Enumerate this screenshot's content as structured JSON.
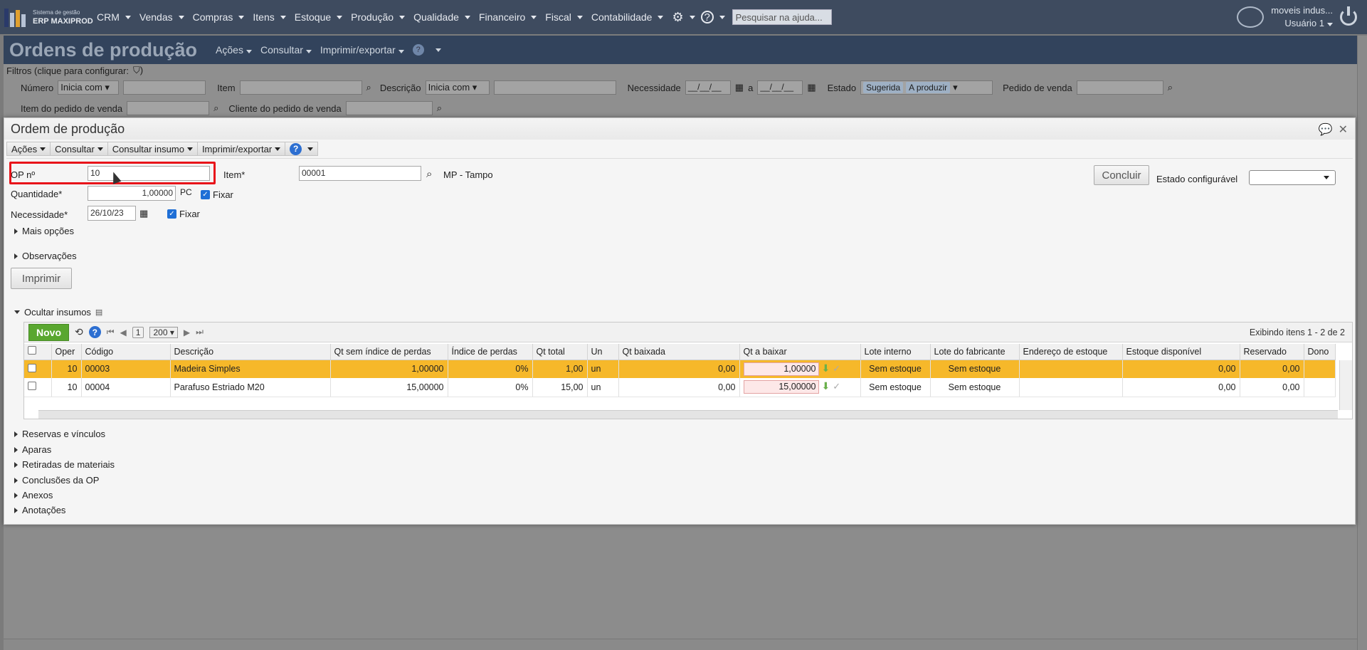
{
  "topbar": {
    "logo_sub": "Sistema de gestão",
    "logo_main": "ERP MAXIPROD",
    "menu": [
      "CRM",
      "Vendas",
      "Compras",
      "Itens",
      "Estoque",
      "Produção",
      "Qualidade",
      "Financeiro",
      "Fiscal",
      "Contabilidade"
    ],
    "search_placeholder": "Pesquisar na ajuda...",
    "company": "moveis indus...",
    "user": "Usuário 1"
  },
  "background": {
    "title": "Ordens de produção",
    "menu": [
      "Ações",
      "Consultar",
      "Imprimir/exportar"
    ],
    "filters_legend": "Filtros (clique para configurar:",
    "labels": {
      "numero": "Número",
      "inicia_com": "Inicia com",
      "item": "Item",
      "descricao": "Descrição",
      "necessidade": "Necessidade",
      "date_placeholder": "__/__/__",
      "a": "a",
      "estado": "Estado",
      "tag1": "Sugerida",
      "tag2": "A produzir",
      "pedido": "Pedido de venda",
      "item_pedido": "Item do pedido de venda",
      "cliente_pedido": "Cliente do pedido de venda"
    }
  },
  "modal": {
    "title": "Ordem de produção",
    "toolbar": [
      "Ações",
      "Consultar",
      "Consultar insumo",
      "Imprimir/exportar"
    ],
    "form": {
      "op_label": "OP nº",
      "op_value": "10",
      "item_label": "Item*",
      "item_value": "00001",
      "item_desc": "MP - Tampo",
      "quantidade_label": "Quantidade*",
      "quantidade_value": "1,00000",
      "unit": "PC",
      "fixar": "Fixar",
      "necessidade_label": "Necessidade*",
      "necessidade_value": "26/10/23",
      "conclude_button": "Concluir",
      "estado_label": "Estado configurável",
      "mais_opcoes": "Mais opções",
      "observacoes": "Observações",
      "imprimir_button": "Imprimir",
      "ocultar_insumos": "Ocultar insumos"
    },
    "grid": {
      "new_button": "Novo",
      "page": "1",
      "page_size": "200",
      "status": "Exibindo itens 1 - 2 de 2",
      "columns": [
        "Oper",
        "Código",
        "Descrição",
        "Qt sem índice de perdas",
        "Índice de perdas",
        "Qt total",
        "Un",
        "Qt baixada",
        "Qt a baixar",
        "Lote interno",
        "Lote do fabricante",
        "Endereço de estoque",
        "Estoque disponível",
        "Reservado",
        "Dono"
      ],
      "rows": [
        {
          "oper": "10",
          "codigo": "00003",
          "descricao": "Madeira Simples",
          "qt_sem": "1,00000",
          "indice": "0%",
          "qt_total": "1,00",
          "un": "un",
          "qt_baixada": "0,00",
          "qt_a_baixar": "1,00000",
          "lote_interno": "Sem estoque",
          "lote_fab": "Sem estoque",
          "endereco": "",
          "estoque_disp": "0,00",
          "reservado": "0,00"
        },
        {
          "oper": "10",
          "codigo": "00004",
          "descricao": "Parafuso Estriado M20",
          "qt_sem": "15,00000",
          "indice": "0%",
          "qt_total": "15,00",
          "un": "un",
          "qt_baixada": "0,00",
          "qt_a_baixar": "15,00000",
          "lote_interno": "Sem estoque",
          "lote_fab": "Sem estoque",
          "endereco": "",
          "estoque_disp": "0,00",
          "reservado": "0,00"
        }
      ]
    },
    "sections": [
      "Reservas e vínculos",
      "Aparas",
      "Retiradas de materiais",
      "Conclusões da OP",
      "Anexos",
      "Anotações"
    ]
  },
  "colors": {
    "topbar": "#3e4b5f",
    "selected_row": "#f6b82a",
    "new_button": "#59a72f",
    "highlight": "#e8141a"
  }
}
